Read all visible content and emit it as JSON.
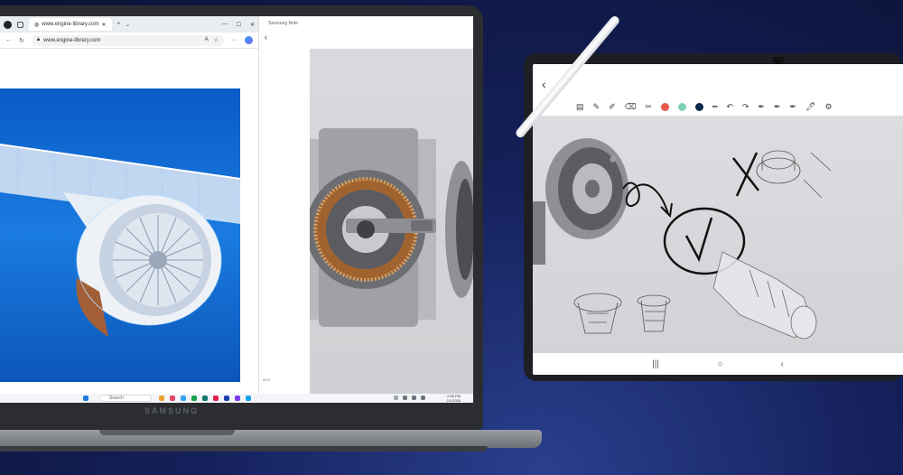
{
  "browser": {
    "tab_title": "www.engine-library.com",
    "address": "www.engine-library.com"
  },
  "note_app": {
    "title": "Samsung Note",
    "zoom": "90%"
  },
  "taskbar": {
    "search_placeholder": "Search",
    "time": "2:56 PM",
    "date": "2/1/2026"
  },
  "laptop": {
    "brand": "SAMSUNG"
  },
  "colors": {
    "palette_red": "#e8584a",
    "palette_teal": "#7fd1b2",
    "palette_navy": "#0d2a4a"
  }
}
